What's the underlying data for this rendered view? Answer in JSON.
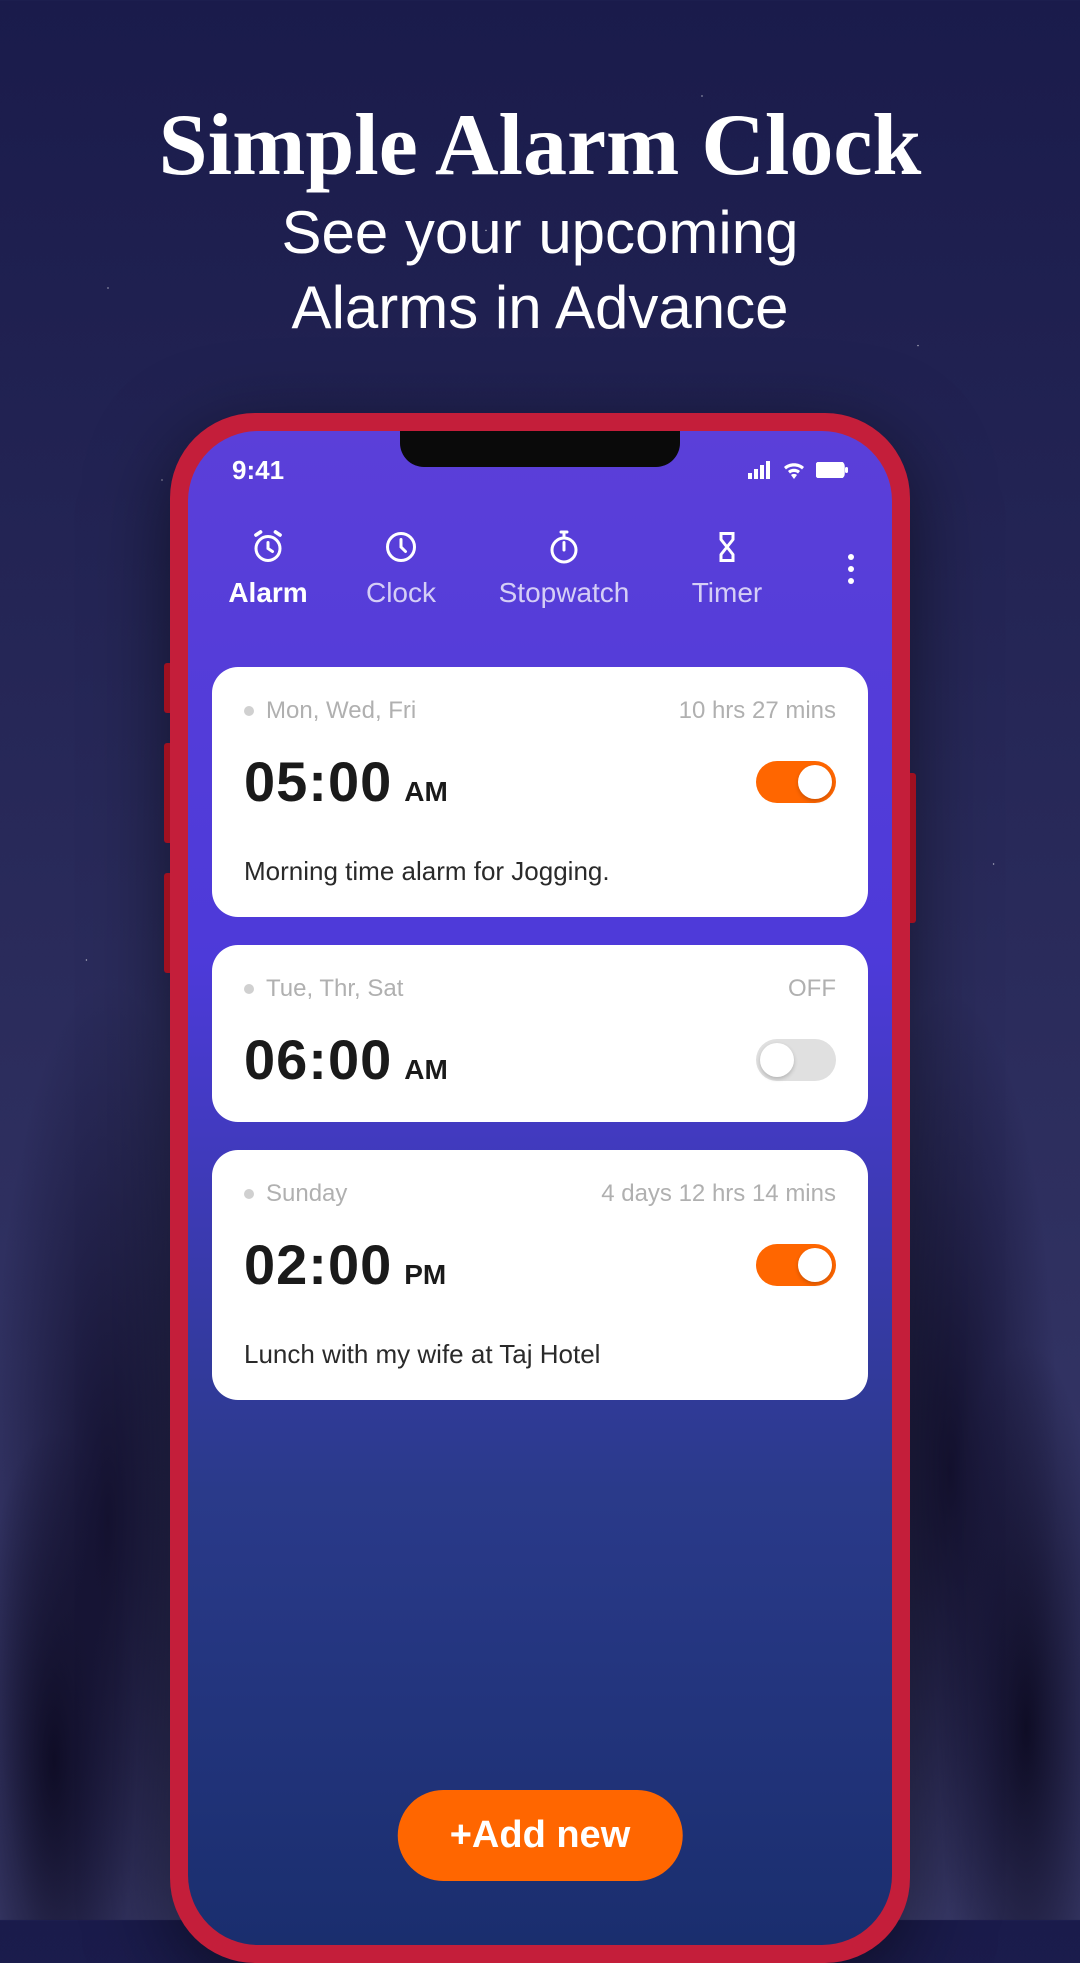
{
  "promo": {
    "title": "Simple Alarm Clock",
    "subtitle_line1": "See your upcoming",
    "subtitle_line2": "Alarms in Advance"
  },
  "status": {
    "time": "9:41"
  },
  "tabs": [
    {
      "label": "Alarm",
      "icon": "alarm-icon",
      "active": true
    },
    {
      "label": "Clock",
      "icon": "clock-icon",
      "active": false
    },
    {
      "label": "Stopwatch",
      "icon": "stopwatch-icon",
      "active": false
    },
    {
      "label": "Timer",
      "icon": "timer-icon",
      "active": false
    }
  ],
  "alarms": [
    {
      "days": "Mon, Wed, Fri",
      "countdown": "10 hrs 27 mins",
      "time": "05:00",
      "ampm": "AM",
      "enabled": true,
      "note": "Morning time alarm for Jogging."
    },
    {
      "days": "Tue, Thr, Sat",
      "countdown": "OFF",
      "time": "06:00",
      "ampm": "AM",
      "enabled": false,
      "note": ""
    },
    {
      "days": "Sunday",
      "countdown": "4 days 12 hrs 14 mins",
      "time": "02:00",
      "ampm": "PM",
      "enabled": true,
      "note": "Lunch with my wife at Taj Hotel"
    }
  ],
  "add_button": "+Add new"
}
